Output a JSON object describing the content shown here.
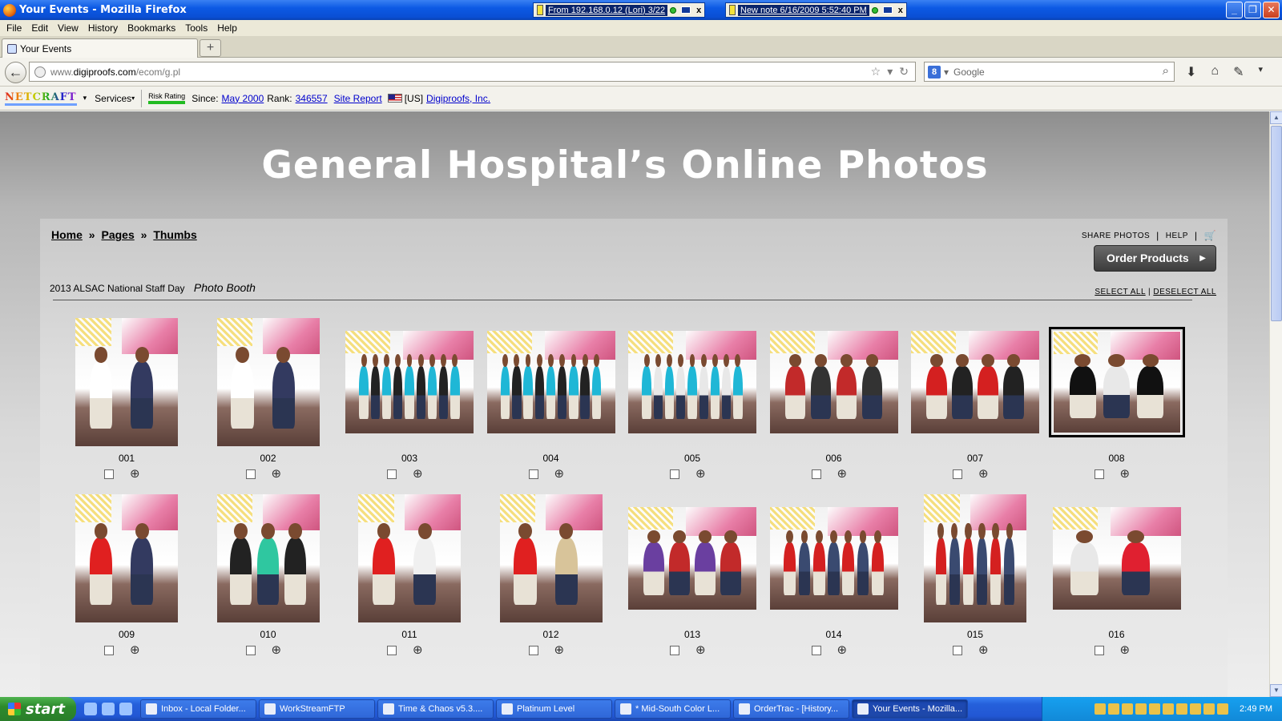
{
  "window": {
    "title": "Your Events - Mozilla Firefox",
    "ext1": "From 192.168.0.12 (Lori) 3/22",
    "ext2": "New note 6/16/2009 5:52:40 PM",
    "ext_close": "x"
  },
  "menu": [
    "File",
    "Edit",
    "View",
    "History",
    "Bookmarks",
    "Tools",
    "Help"
  ],
  "tab": {
    "label": "Your Events",
    "new_tab": "+"
  },
  "nav": {
    "url_prefix": "www.",
    "url_domain": "digiproofs.com",
    "url_path": "/ecom/g.pl",
    "search_placeholder": "Google"
  },
  "netcraft": {
    "logo": "NETCRAFT",
    "services": "Services",
    "risk": "Risk Rating",
    "since_label": "Since:",
    "since_value": "May 2000",
    "rank_label": "Rank:",
    "rank_value": "346557",
    "site_report": "Site Report",
    "country": "[US]",
    "company": "Digiproofs, Inc."
  },
  "hero": {
    "title": "General Hospital’s Online Photos"
  },
  "breadcrumb": {
    "home": "Home",
    "pages": "Pages",
    "thumbs": "Thumbs",
    "sep": "»"
  },
  "toplinks": {
    "share": "SHARE PHOTOS",
    "help": "HELP",
    "sep": "|"
  },
  "order_button": "Order Products",
  "event": {
    "name": "2013 ALSAC National Staff Day",
    "subtitle": "Photo Booth"
  },
  "select": {
    "all": "SELECT ALL",
    "none": "DESELECT ALL",
    "sep": "|"
  },
  "photos": [
    {
      "label": "001",
      "orient": "portrait",
      "people": 2,
      "palette": [
        "#ffffff",
        "#333a60"
      ]
    },
    {
      "label": "002",
      "orient": "portrait",
      "people": 2,
      "palette": [
        "#ffffff",
        "#333a60"
      ]
    },
    {
      "label": "003",
      "orient": "landscape",
      "people": 9,
      "palette": [
        "#1fb7d6",
        "#222222"
      ]
    },
    {
      "label": "004",
      "orient": "landscape",
      "people": 9,
      "palette": [
        "#1fb7d6",
        "#222222"
      ]
    },
    {
      "label": "005",
      "orient": "landscape",
      "people": 9,
      "palette": [
        "#1fb7d6",
        "#e8e8e8"
      ]
    },
    {
      "label": "006",
      "orient": "landscape",
      "people": 4,
      "palette": [
        "#c22a2a",
        "#333333"
      ]
    },
    {
      "label": "007",
      "orient": "landscape",
      "people": 4,
      "palette": [
        "#d42020",
        "#222222"
      ]
    },
    {
      "label": "008",
      "orient": "landscape",
      "people": 3,
      "palette": [
        "#111111",
        "#e8e8e8"
      ],
      "selected": true
    },
    {
      "label": "009",
      "orient": "portrait",
      "people": 2,
      "palette": [
        "#e02020",
        "#333a60"
      ]
    },
    {
      "label": "010",
      "orient": "portrait",
      "people": 3,
      "palette": [
        "#222222",
        "#2fc7a0"
      ]
    },
    {
      "label": "011",
      "orient": "portrait",
      "people": 2,
      "palette": [
        "#e02020",
        "#f0f0f0"
      ]
    },
    {
      "label": "012",
      "orient": "portrait",
      "people": 2,
      "palette": [
        "#e02020",
        "#d8c49a"
      ]
    },
    {
      "label": "013",
      "orient": "landscape",
      "people": 4,
      "palette": [
        "#6a3fa0",
        "#c22a2a"
      ]
    },
    {
      "label": "014",
      "orient": "landscape",
      "people": 7,
      "palette": [
        "#d42020",
        "#3a4a70"
      ]
    },
    {
      "label": "015",
      "orient": "portrait",
      "people": 6,
      "palette": [
        "#d42020",
        "#3a4a70"
      ]
    },
    {
      "label": "016",
      "orient": "landscape",
      "people": 2,
      "palette": [
        "#e8e8e8",
        "#e02030"
      ]
    }
  ],
  "taskbar": {
    "start": "start",
    "tasks": [
      {
        "label": "Inbox - Local Folder..."
      },
      {
        "label": "WorkStreamFTP"
      },
      {
        "label": "Time & Chaos v5.3...."
      },
      {
        "label": "Platinum Level"
      },
      {
        "label": "* Mid-South Color L..."
      },
      {
        "label": "OrderTrac - [History..."
      },
      {
        "label": "Your Events - Mozilla...",
        "active": true
      }
    ],
    "clock": "2:49 PM"
  }
}
